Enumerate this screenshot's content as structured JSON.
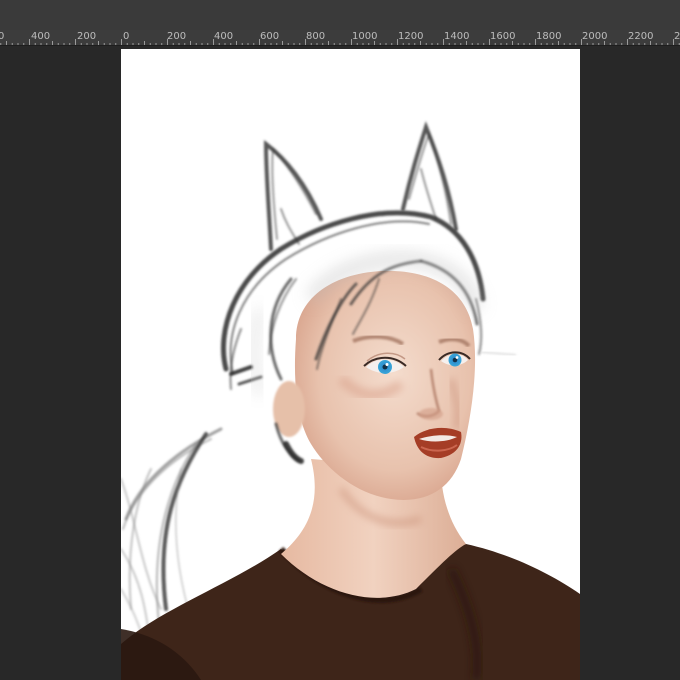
{
  "ruler": {
    "labels": [
      "0",
      "400",
      "200",
      "0",
      "200",
      "400",
      "600",
      "800",
      "1000",
      "1200",
      "1400",
      "1600",
      "1800",
      "2000",
      "2200",
      "2"
    ]
  },
  "canvas": {
    "background": "#ffffff",
    "content": "digital painting in progress"
  },
  "colors": {
    "workspace": "#282828",
    "ruler": "#3c3c3c",
    "ruler_text": "#bdbdbd",
    "shirt": "#3e2519",
    "skin": "#eccbb8",
    "lips": "#a53d26",
    "eyes": "#3aa6d8"
  }
}
